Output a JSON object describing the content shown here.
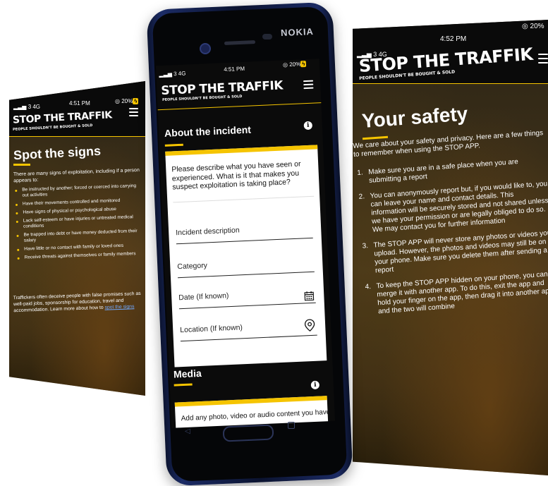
{
  "brand": {
    "name": "STOP THE TRAFFIK",
    "tagline": "PEOPLE SHOULDN'T BE BOUGHT & SOLD",
    "phone_brand": "NOKIA",
    "accent_color": "#f5c400"
  },
  "left_screen": {
    "status": {
      "carrier": "3 4G",
      "time": "4:51 PM",
      "battery": "20%"
    },
    "title": "Spot the signs",
    "intro": "There are many signs of exploitation, including if a person appears to:",
    "bullets": [
      "Be instructed by another; forced or coerced into carrying out activities",
      "Have their movements controlled and monitored",
      "Have signs of physical or psychological abuse",
      "Lack self-esteem or have injuries or untreated medical conditions",
      "Be trapped into debt or have money deducted from their salary",
      "Have little or no contact with family or loved ones",
      "Receive threats against themselves or family members"
    ],
    "footer_text": "Traffickers often deceive people with false promises such as well-paid jobs, sponsorship for education, travel and accommodation. Learn more about how to",
    "footer_link": "spot the signs"
  },
  "center_screen": {
    "status": {
      "carrier": "3 4G",
      "time": "4:51 PM",
      "battery": "20%"
    },
    "section_title": "About the incident",
    "prompt": "Please describe what you have seen or experienced. What is it that makes you suspect exploitation is taking place?",
    "fields": [
      {
        "label": "Incident description"
      },
      {
        "label": "Category"
      },
      {
        "label": "Date (If known)"
      },
      {
        "label": "Location (If known)"
      }
    ],
    "media_title": "Media",
    "media_text": "Add any photo, video or audio content you have"
  },
  "right_screen": {
    "status": {
      "carrier": "3 4G",
      "time": "4:52 PM",
      "battery": "20%"
    },
    "title": "Your safety",
    "intro": "We care about your safety and privacy. Here are a few things to remember when using the STOP APP.",
    "items": [
      {
        "num": "1.",
        "text": "Make sure you are in a safe place when you are submitting a report"
      },
      {
        "num": "2.",
        "text": "You can anonymously report but, if you would like to, you can leave your name and contact details. This information will be securely stored and not shared unless we have your permission or are legally obliged to do so. We may contact you for further information"
      },
      {
        "num": "3.",
        "text": "The STOP APP will never store any photos or videos you upload. However, the photos and videos may still be on your phone. Make sure you delete them after sending a report"
      },
      {
        "num": "4.",
        "text": "To keep the STOP APP hidden on your phone, you can merge it with another app. To do this, exit the app and hold your finger on the app, then drag it into another app and the two will combine"
      }
    ]
  }
}
